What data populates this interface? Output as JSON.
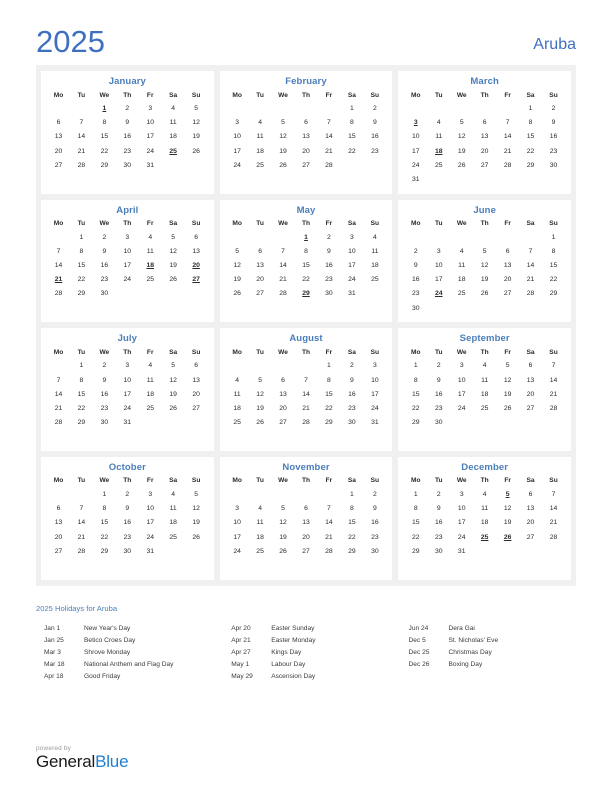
{
  "header": {
    "year": "2025",
    "country": "Aruba"
  },
  "months": [
    {
      "name": "January",
      "weekdays": [
        "Mo",
        "Tu",
        "We",
        "Th",
        "Fr",
        "Sa",
        "Su"
      ],
      "weeks": [
        [
          "",
          "",
          "1",
          "2",
          "3",
          "4",
          "5"
        ],
        [
          "6",
          "7",
          "8",
          "9",
          "10",
          "11",
          "12"
        ],
        [
          "13",
          "14",
          "15",
          "16",
          "17",
          "18",
          "19"
        ],
        [
          "20",
          "21",
          "22",
          "23",
          "24",
          "25",
          "26"
        ],
        [
          "27",
          "28",
          "29",
          "30",
          "31",
          "",
          ""
        ],
        [
          "",
          "",
          "",
          "",
          "",
          "",
          ""
        ]
      ],
      "holidays": [
        "1",
        "25"
      ]
    },
    {
      "name": "February",
      "weekdays": [
        "Mo",
        "Tu",
        "We",
        "Th",
        "Fr",
        "Sa",
        "Su"
      ],
      "weeks": [
        [
          "",
          "",
          "",
          "",
          "",
          "1",
          "2"
        ],
        [
          "3",
          "4",
          "5",
          "6",
          "7",
          "8",
          "9"
        ],
        [
          "10",
          "11",
          "12",
          "13",
          "14",
          "15",
          "16"
        ],
        [
          "17",
          "18",
          "19",
          "20",
          "21",
          "22",
          "23"
        ],
        [
          "24",
          "25",
          "26",
          "27",
          "28",
          "",
          ""
        ],
        [
          "",
          "",
          "",
          "",
          "",
          "",
          ""
        ]
      ],
      "holidays": []
    },
    {
      "name": "March",
      "weekdays": [
        "Mo",
        "Tu",
        "We",
        "Th",
        "Fr",
        "Sa",
        "Su"
      ],
      "weeks": [
        [
          "",
          "",
          "",
          "",
          "",
          "1",
          "2"
        ],
        [
          "3",
          "4",
          "5",
          "6",
          "7",
          "8",
          "9"
        ],
        [
          "10",
          "11",
          "12",
          "13",
          "14",
          "15",
          "16"
        ],
        [
          "17",
          "18",
          "19",
          "20",
          "21",
          "22",
          "23"
        ],
        [
          "24",
          "25",
          "26",
          "27",
          "28",
          "29",
          "30"
        ],
        [
          "31",
          "",
          "",
          "",
          "",
          "",
          ""
        ]
      ],
      "holidays": [
        "3",
        "18"
      ]
    },
    {
      "name": "April",
      "weekdays": [
        "Mo",
        "Tu",
        "We",
        "Th",
        "Fr",
        "Sa",
        "Su"
      ],
      "weeks": [
        [
          "",
          "1",
          "2",
          "3",
          "4",
          "5",
          "6"
        ],
        [
          "7",
          "8",
          "9",
          "10",
          "11",
          "12",
          "13"
        ],
        [
          "14",
          "15",
          "16",
          "17",
          "18",
          "19",
          "20"
        ],
        [
          "21",
          "22",
          "23",
          "24",
          "25",
          "26",
          "27"
        ],
        [
          "28",
          "29",
          "30",
          "",
          "",
          "",
          ""
        ],
        [
          "",
          "",
          "",
          "",
          "",
          "",
          ""
        ]
      ],
      "holidays": [
        "18",
        "20",
        "21",
        "27"
      ]
    },
    {
      "name": "May",
      "weekdays": [
        "Mo",
        "Tu",
        "We",
        "Th",
        "Fr",
        "Sa",
        "Su"
      ],
      "weeks": [
        [
          "",
          "",
          "",
          "1",
          "2",
          "3",
          "4"
        ],
        [
          "5",
          "6",
          "7",
          "8",
          "9",
          "10",
          "11"
        ],
        [
          "12",
          "13",
          "14",
          "15",
          "16",
          "17",
          "18"
        ],
        [
          "19",
          "20",
          "21",
          "22",
          "23",
          "24",
          "25"
        ],
        [
          "26",
          "27",
          "28",
          "29",
          "30",
          "31",
          ""
        ],
        [
          "",
          "",
          "",
          "",
          "",
          "",
          ""
        ]
      ],
      "holidays": [
        "1",
        "29"
      ]
    },
    {
      "name": "June",
      "weekdays": [
        "Mo",
        "Tu",
        "We",
        "Th",
        "Fr",
        "Sa",
        "Su"
      ],
      "weeks": [
        [
          "",
          "",
          "",
          "",
          "",
          "",
          "1"
        ],
        [
          "2",
          "3",
          "4",
          "5",
          "6",
          "7",
          "8"
        ],
        [
          "9",
          "10",
          "11",
          "12",
          "13",
          "14",
          "15"
        ],
        [
          "16",
          "17",
          "18",
          "19",
          "20",
          "21",
          "22"
        ],
        [
          "23",
          "24",
          "25",
          "26",
          "27",
          "28",
          "29"
        ],
        [
          "30",
          "",
          "",
          "",
          "",
          "",
          ""
        ]
      ],
      "holidays": [
        "24"
      ]
    },
    {
      "name": "July",
      "weekdays": [
        "Mo",
        "Tu",
        "We",
        "Th",
        "Fr",
        "Sa",
        "Su"
      ],
      "weeks": [
        [
          "",
          "1",
          "2",
          "3",
          "4",
          "5",
          "6"
        ],
        [
          "7",
          "8",
          "9",
          "10",
          "11",
          "12",
          "13"
        ],
        [
          "14",
          "15",
          "16",
          "17",
          "18",
          "19",
          "20"
        ],
        [
          "21",
          "22",
          "23",
          "24",
          "25",
          "26",
          "27"
        ],
        [
          "28",
          "29",
          "30",
          "31",
          "",
          "",
          ""
        ],
        [
          "",
          "",
          "",
          "",
          "",
          "",
          ""
        ]
      ],
      "holidays": []
    },
    {
      "name": "August",
      "weekdays": [
        "Mo",
        "Tu",
        "We",
        "Th",
        "Fr",
        "Sa",
        "Su"
      ],
      "weeks": [
        [
          "",
          "",
          "",
          "",
          "1",
          "2",
          "3"
        ],
        [
          "4",
          "5",
          "6",
          "7",
          "8",
          "9",
          "10"
        ],
        [
          "11",
          "12",
          "13",
          "14",
          "15",
          "16",
          "17"
        ],
        [
          "18",
          "19",
          "20",
          "21",
          "22",
          "23",
          "24"
        ],
        [
          "25",
          "26",
          "27",
          "28",
          "29",
          "30",
          "31"
        ],
        [
          "",
          "",
          "",
          "",
          "",
          "",
          ""
        ]
      ],
      "holidays": []
    },
    {
      "name": "September",
      "weekdays": [
        "Mo",
        "Tu",
        "We",
        "Th",
        "Fr",
        "Sa",
        "Su"
      ],
      "weeks": [
        [
          "1",
          "2",
          "3",
          "4",
          "5",
          "6",
          "7"
        ],
        [
          "8",
          "9",
          "10",
          "11",
          "12",
          "13",
          "14"
        ],
        [
          "15",
          "16",
          "17",
          "18",
          "19",
          "20",
          "21"
        ],
        [
          "22",
          "23",
          "24",
          "25",
          "26",
          "27",
          "28"
        ],
        [
          "29",
          "30",
          "",
          "",
          "",
          "",
          ""
        ],
        [
          "",
          "",
          "",
          "",
          "",
          "",
          ""
        ]
      ],
      "holidays": []
    },
    {
      "name": "October",
      "weekdays": [
        "Mo",
        "Tu",
        "We",
        "Th",
        "Fr",
        "Sa",
        "Su"
      ],
      "weeks": [
        [
          "",
          "",
          "1",
          "2",
          "3",
          "4",
          "5"
        ],
        [
          "6",
          "7",
          "8",
          "9",
          "10",
          "11",
          "12"
        ],
        [
          "13",
          "14",
          "15",
          "16",
          "17",
          "18",
          "19"
        ],
        [
          "20",
          "21",
          "22",
          "23",
          "24",
          "25",
          "26"
        ],
        [
          "27",
          "28",
          "29",
          "30",
          "31",
          "",
          ""
        ],
        [
          "",
          "",
          "",
          "",
          "",
          "",
          ""
        ]
      ],
      "holidays": []
    },
    {
      "name": "November",
      "weekdays": [
        "Mo",
        "Tu",
        "We",
        "Th",
        "Fr",
        "Sa",
        "Su"
      ],
      "weeks": [
        [
          "",
          "",
          "",
          "",
          "",
          "1",
          "2"
        ],
        [
          "3",
          "4",
          "5",
          "6",
          "7",
          "8",
          "9"
        ],
        [
          "10",
          "11",
          "12",
          "13",
          "14",
          "15",
          "16"
        ],
        [
          "17",
          "18",
          "19",
          "20",
          "21",
          "22",
          "23"
        ],
        [
          "24",
          "25",
          "26",
          "27",
          "28",
          "29",
          "30"
        ],
        [
          "",
          "",
          "",
          "",
          "",
          "",
          ""
        ]
      ],
      "holidays": []
    },
    {
      "name": "December",
      "weekdays": [
        "Mo",
        "Tu",
        "We",
        "Th",
        "Fr",
        "Sa",
        "Su"
      ],
      "weeks": [
        [
          "1",
          "2",
          "3",
          "4",
          "5",
          "6",
          "7"
        ],
        [
          "8",
          "9",
          "10",
          "11",
          "12",
          "13",
          "14"
        ],
        [
          "15",
          "16",
          "17",
          "18",
          "19",
          "20",
          "21"
        ],
        [
          "22",
          "23",
          "24",
          "25",
          "26",
          "27",
          "28"
        ],
        [
          "29",
          "30",
          "31",
          "",
          "",
          "",
          ""
        ],
        [
          "",
          "",
          "",
          "",
          "",
          "",
          ""
        ]
      ],
      "holidays": [
        "5",
        "25",
        "26"
      ]
    }
  ],
  "holidays_section": {
    "heading": "2025 Holidays for Aruba",
    "columns": [
      [
        {
          "date": "Jan 1",
          "name": "New Year's Day"
        },
        {
          "date": "Jan 25",
          "name": "Betico Croes Day"
        },
        {
          "date": "Mar 3",
          "name": "Shrove Monday"
        },
        {
          "date": "Mar 18",
          "name": "National Anthem and Flag Day"
        },
        {
          "date": "Apr 18",
          "name": "Good Friday"
        }
      ],
      [
        {
          "date": "Apr 20",
          "name": "Easter Sunday"
        },
        {
          "date": "Apr 21",
          "name": "Easter Monday"
        },
        {
          "date": "Apr 27",
          "name": "Kings Day"
        },
        {
          "date": "May 1",
          "name": "Labour Day"
        },
        {
          "date": "May 29",
          "name": "Ascension Day"
        }
      ],
      [
        {
          "date": "Jun 24",
          "name": "Dera Gai"
        },
        {
          "date": "Dec 5",
          "name": "St. Nicholas' Eve"
        },
        {
          "date": "Dec 25",
          "name": "Christmas Day"
        },
        {
          "date": "Dec 26",
          "name": "Boxing Day"
        }
      ]
    ]
  },
  "footer": {
    "powered_by": "powered by",
    "logo_part1": "General",
    "logo_part2": "Blue"
  },
  "colors": {
    "accent_blue": "#4a7ebb",
    "holiday_red": "#e00000",
    "panel_gray": "#f0f0f0",
    "logo_blue": "#1f7fd0"
  }
}
